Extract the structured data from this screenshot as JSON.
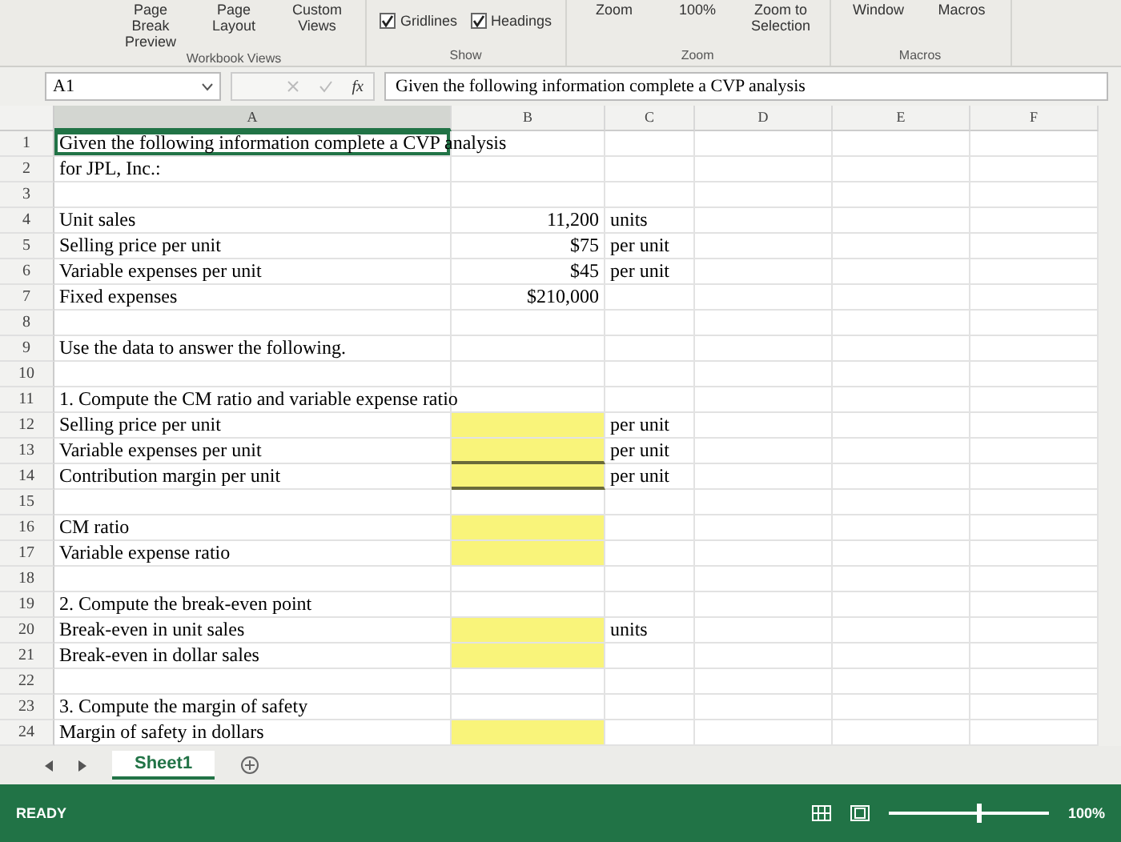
{
  "ribbon": {
    "groups": [
      {
        "label": "Workbook Views",
        "items": [
          {
            "kind": "view",
            "label": "Page Break Preview"
          },
          {
            "kind": "view",
            "label": "Page Layout"
          },
          {
            "kind": "view",
            "label": "Custom Views"
          }
        ]
      },
      {
        "label": "Show",
        "items": [
          {
            "kind": "check",
            "label": "Gridlines",
            "checked": true
          },
          {
            "kind": "check",
            "label": "Headings",
            "checked": true
          }
        ]
      },
      {
        "label": "Zoom",
        "items": [
          {
            "kind": "view",
            "label": "Zoom"
          },
          {
            "kind": "view",
            "label": "100%"
          },
          {
            "kind": "view",
            "label": "Zoom to Selection"
          }
        ]
      },
      {
        "label": "Macros",
        "items": [
          {
            "kind": "view",
            "label": "Window"
          },
          {
            "kind": "view",
            "label": "Macros"
          }
        ]
      }
    ]
  },
  "formula_bar": {
    "name_box": "A1",
    "fx": "fx",
    "formula": "Given the following information complete a CVP analysis"
  },
  "columns": [
    {
      "label": "A",
      "selected": true
    },
    {
      "label": "B",
      "selected": false
    },
    {
      "label": "C",
      "selected": false
    },
    {
      "label": "D",
      "selected": false
    },
    {
      "label": "E",
      "selected": false
    },
    {
      "label": "F",
      "selected": false
    }
  ],
  "rows": [
    {
      "number": "1",
      "a": "Given the following information complete a CVP analysis",
      "selected": true,
      "input": false,
      "underlined": false
    },
    {
      "number": "2",
      "a": "for JPL, Inc.:",
      "selected": false,
      "input": false,
      "underlined": false
    },
    {
      "number": "3",
      "selected": false,
      "input": false,
      "underlined": false
    },
    {
      "number": "4",
      "a": "Unit sales",
      "b": "11,200",
      "c": "units",
      "selected": false,
      "input": false,
      "underlined": false
    },
    {
      "number": "5",
      "a": "Selling price per unit",
      "b": "$75",
      "c": "per unit",
      "selected": false,
      "input": false,
      "underlined": false
    },
    {
      "number": "6",
      "a": "Variable expenses per unit",
      "b": "$45",
      "c": "per unit",
      "selected": false,
      "input": false,
      "underlined": false
    },
    {
      "number": "7",
      "a": "Fixed expenses",
      "b": "$210,000",
      "selected": false,
      "input": false,
      "underlined": false
    },
    {
      "number": "8",
      "selected": false,
      "input": false,
      "underlined": false
    },
    {
      "number": "9",
      "a": "Use the data to answer the following.",
      "selected": false,
      "input": false,
      "underlined": false
    },
    {
      "number": "10",
      "selected": false,
      "input": false,
      "underlined": false
    },
    {
      "number": "11",
      "a": "1. Compute the CM ratio and variable expense ratio",
      "selected": false,
      "input": false,
      "underlined": false
    },
    {
      "number": "12",
      "a": "Selling price per unit",
      "c": "per unit",
      "selected": false,
      "input": true,
      "underlined": false
    },
    {
      "number": "13",
      "a": "Variable expenses per unit",
      "c": "per unit",
      "selected": false,
      "input": true,
      "underlined": true
    },
    {
      "number": "14",
      "a": "Contribution margin per unit",
      "c": "per unit",
      "selected": false,
      "input": true,
      "underlined": true
    },
    {
      "number": "15",
      "selected": false,
      "input": false,
      "underlined": false
    },
    {
      "number": "16",
      "a": "CM ratio",
      "selected": false,
      "input": true,
      "underlined": false
    },
    {
      "number": "17",
      "a": "Variable expense ratio",
      "selected": false,
      "input": true,
      "underlined": false
    },
    {
      "number": "18",
      "selected": false,
      "input": false,
      "underlined": false
    },
    {
      "number": "19",
      "a": "2. Compute the break-even point",
      "selected": false,
      "input": false,
      "underlined": false
    },
    {
      "number": "20",
      "a": "Break-even in unit sales",
      "c": "units",
      "selected": false,
      "input": true,
      "underlined": false
    },
    {
      "number": "21",
      "a": "Break-even in dollar sales",
      "selected": false,
      "input": true,
      "underlined": false
    },
    {
      "number": "22",
      "selected": false,
      "input": false,
      "underlined": false
    },
    {
      "number": "23",
      "a": "3. Compute the margin of safety",
      "selected": false,
      "input": false,
      "underlined": false
    },
    {
      "number": "24",
      "a": "Margin of safety in dollars",
      "selected": false,
      "input": true,
      "underlined": false
    }
  ],
  "sheet_tabs": [
    {
      "label": "Sheet1",
      "selected": true
    }
  ],
  "status_bar": {
    "mode": "READY",
    "zoom": {
      "level": 0.55,
      "reading": "100%"
    }
  }
}
